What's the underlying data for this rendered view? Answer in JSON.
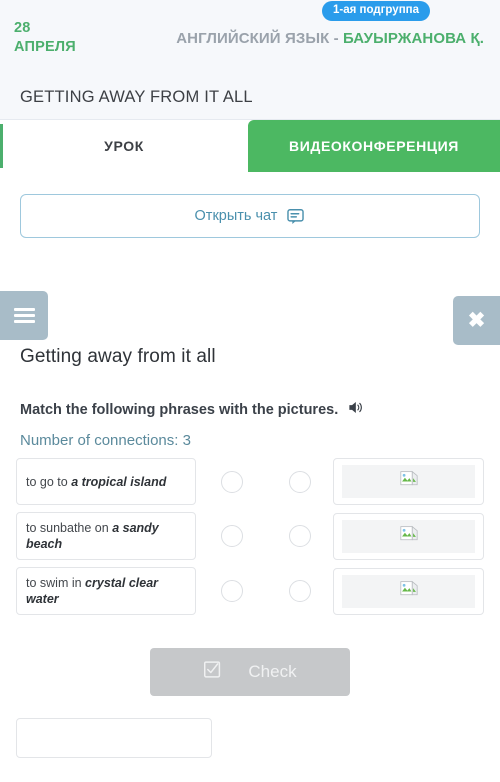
{
  "header": {
    "date_line1": "28",
    "date_line2": "АПРЕЛЯ",
    "badge": "1-ая подгруппа",
    "subject": "АНГЛИЙСКИЙ ЯЗЫК - ",
    "teacher": "БАУЫРЖАНОВА Қ.",
    "accent_green": "#4caf6d",
    "badge_blue": "#2a9ceb"
  },
  "lesson_bar": {
    "title": "GETTING AWAY FROM IT ALL"
  },
  "tabs": [
    {
      "label": "УРОК",
      "active": false
    },
    {
      "label": "ВИДЕОКОНФЕРЕНЦИЯ",
      "active": true
    }
  ],
  "chat": {
    "label": "Открыть чат",
    "icon": "chat-bubble-icon"
  },
  "exercise": {
    "menu_icon": "hamburger-menu-icon",
    "close_icon": "close-icon",
    "title": "Getting away from it all",
    "instruction": "Match the following phrases with the pictures.",
    "audio_icon": "speaker-icon",
    "connections_label": "Number of connections: 3",
    "pairs": [
      {
        "phrase_prefix": "to go to ",
        "phrase_bold": "a tropical island",
        "image_alt": "broken-image-icon"
      },
      {
        "phrase_prefix": "to sunbathe on ",
        "phrase_bold": "a sandy beach",
        "image_alt": "broken-image-icon"
      },
      {
        "phrase_prefix": "to swim in ",
        "phrase_bold": "crystal clear water",
        "image_alt": "broken-image-icon"
      }
    ],
    "check_button": {
      "label": "Check",
      "icon": "checkbox-icon",
      "disabled": true
    }
  }
}
